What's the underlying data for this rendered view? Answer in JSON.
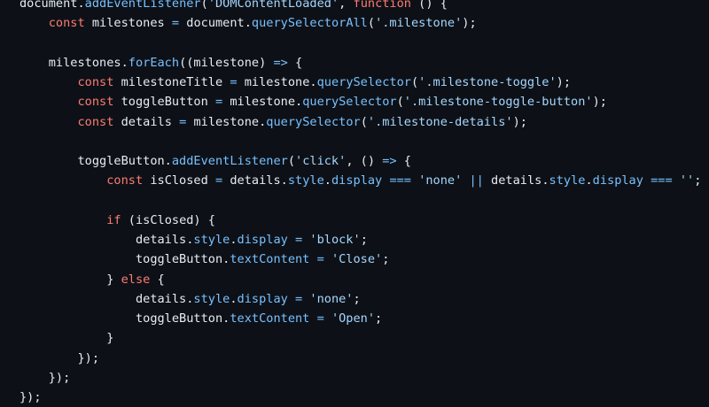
{
  "colors": {
    "background": "#0d1117",
    "plain": "#e6edf3",
    "keyword": "#ff7b72",
    "string": "#a5d6ff",
    "property": "#79c0ff",
    "operator": "#79c0ff"
  },
  "code": {
    "lines": [
      [
        [
          "plain",
          "document."
        ],
        [
          "prop",
          "addEventListener"
        ],
        [
          "plain",
          "("
        ],
        [
          "string",
          "'DOMContentLoaded'"
        ],
        [
          "plain",
          ", "
        ],
        [
          "keyword",
          "function"
        ],
        [
          "plain",
          " () {"
        ]
      ],
      [
        [
          "plain",
          "    "
        ],
        [
          "keyword",
          "const"
        ],
        [
          "plain",
          " milestones "
        ],
        [
          "op",
          "="
        ],
        [
          "plain",
          " document."
        ],
        [
          "prop",
          "querySelectorAll"
        ],
        [
          "plain",
          "("
        ],
        [
          "string",
          "'.milestone'"
        ],
        [
          "plain",
          ");"
        ]
      ],
      [],
      [
        [
          "plain",
          "    milestones."
        ],
        [
          "prop",
          "forEach"
        ],
        [
          "plain",
          "((milestone) "
        ],
        [
          "op",
          "=>"
        ],
        [
          "plain",
          " {"
        ]
      ],
      [
        [
          "plain",
          "        "
        ],
        [
          "keyword",
          "const"
        ],
        [
          "plain",
          " milestoneTitle "
        ],
        [
          "op",
          "="
        ],
        [
          "plain",
          " milestone."
        ],
        [
          "prop",
          "querySelector"
        ],
        [
          "plain",
          "("
        ],
        [
          "string",
          "'.milestone-toggle'"
        ],
        [
          "plain",
          ");"
        ]
      ],
      [
        [
          "plain",
          "        "
        ],
        [
          "keyword",
          "const"
        ],
        [
          "plain",
          " toggleButton "
        ],
        [
          "op",
          "="
        ],
        [
          "plain",
          " milestone."
        ],
        [
          "prop",
          "querySelector"
        ],
        [
          "plain",
          "("
        ],
        [
          "string",
          "'.milestone-toggle-button'"
        ],
        [
          "plain",
          ");"
        ]
      ],
      [
        [
          "plain",
          "        "
        ],
        [
          "keyword",
          "const"
        ],
        [
          "plain",
          " details "
        ],
        [
          "op",
          "="
        ],
        [
          "plain",
          " milestone."
        ],
        [
          "prop",
          "querySelector"
        ],
        [
          "plain",
          "("
        ],
        [
          "string",
          "'.milestone-details'"
        ],
        [
          "plain",
          ");"
        ]
      ],
      [],
      [
        [
          "plain",
          "        toggleButton."
        ],
        [
          "prop",
          "addEventListener"
        ],
        [
          "plain",
          "("
        ],
        [
          "string",
          "'click'"
        ],
        [
          "plain",
          ", () "
        ],
        [
          "op",
          "=>"
        ],
        [
          "plain",
          " {"
        ]
      ],
      [
        [
          "plain",
          "            "
        ],
        [
          "keyword",
          "const"
        ],
        [
          "plain",
          " isClosed "
        ],
        [
          "op",
          "="
        ],
        [
          "plain",
          " details."
        ],
        [
          "prop",
          "style"
        ],
        [
          "plain",
          "."
        ],
        [
          "prop",
          "display"
        ],
        [
          "plain",
          " "
        ],
        [
          "op",
          "==="
        ],
        [
          "plain",
          " "
        ],
        [
          "string",
          "'none'"
        ],
        [
          "plain",
          " "
        ],
        [
          "op",
          "||"
        ],
        [
          "plain",
          " details."
        ],
        [
          "prop",
          "style"
        ],
        [
          "plain",
          "."
        ],
        [
          "prop",
          "display"
        ],
        [
          "plain",
          " "
        ],
        [
          "op",
          "==="
        ],
        [
          "plain",
          " "
        ],
        [
          "string",
          "''"
        ],
        [
          "plain",
          ";"
        ]
      ],
      [],
      [
        [
          "plain",
          "            "
        ],
        [
          "keyword",
          "if"
        ],
        [
          "plain",
          " (isClosed) {"
        ]
      ],
      [
        [
          "plain",
          "                details."
        ],
        [
          "prop",
          "style"
        ],
        [
          "plain",
          "."
        ],
        [
          "prop",
          "display"
        ],
        [
          "plain",
          " "
        ],
        [
          "op",
          "="
        ],
        [
          "plain",
          " "
        ],
        [
          "string",
          "'block'"
        ],
        [
          "plain",
          ";"
        ]
      ],
      [
        [
          "plain",
          "                toggleButton."
        ],
        [
          "prop",
          "textContent"
        ],
        [
          "plain",
          " "
        ],
        [
          "op",
          "="
        ],
        [
          "plain",
          " "
        ],
        [
          "string",
          "'Close'"
        ],
        [
          "plain",
          ";"
        ]
      ],
      [
        [
          "plain",
          "            } "
        ],
        [
          "keyword",
          "else"
        ],
        [
          "plain",
          " {"
        ]
      ],
      [
        [
          "plain",
          "                details."
        ],
        [
          "prop",
          "style"
        ],
        [
          "plain",
          "."
        ],
        [
          "prop",
          "display"
        ],
        [
          "plain",
          " "
        ],
        [
          "op",
          "="
        ],
        [
          "plain",
          " "
        ],
        [
          "string",
          "'none'"
        ],
        [
          "plain",
          ";"
        ]
      ],
      [
        [
          "plain",
          "                toggleButton."
        ],
        [
          "prop",
          "textContent"
        ],
        [
          "plain",
          " "
        ],
        [
          "op",
          "="
        ],
        [
          "plain",
          " "
        ],
        [
          "string",
          "'Open'"
        ],
        [
          "plain",
          ";"
        ]
      ],
      [
        [
          "plain",
          "            }"
        ]
      ],
      [
        [
          "plain",
          "        });"
        ]
      ],
      [
        [
          "plain",
          "    });"
        ]
      ],
      [
        [
          "plain",
          "});"
        ]
      ]
    ]
  }
}
